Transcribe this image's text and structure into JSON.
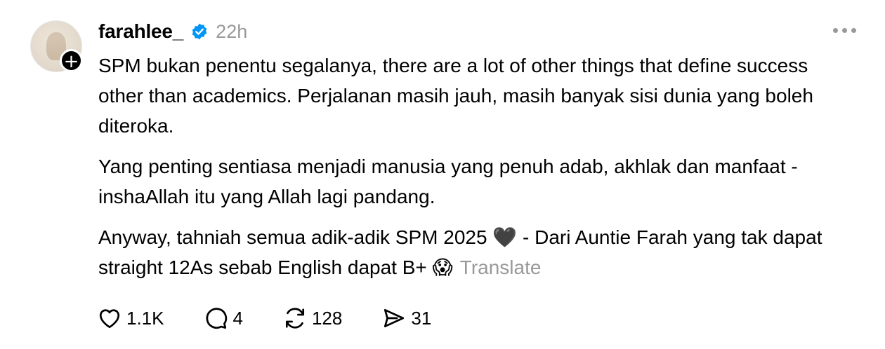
{
  "post": {
    "username": "farahlee_",
    "time": "22h",
    "paragraphs": [
      "SPM bukan penentu segalanya, there are a lot of other things that define success other than academics. Perjalanan masih jauh, masih banyak sisi dunia yang boleh diteroka.",
      "Yang penting sentiasa menjadi manusia yang penuh adab, akhlak dan manfaat - inshaAllah itu yang Allah lagi pandang."
    ],
    "last_paragraph": {
      "part1": "Anyway, tahniah semua adik-adik SPM 2025",
      "heart_emoji": "🖤",
      "part2": "- Dari Auntie Farah yang tak dapat straight 12As sebab English dapat B+",
      "face_emoji": "😱"
    },
    "translate_label": "Translate"
  },
  "actions": {
    "likes": "1.1K",
    "replies": "4",
    "reposts": "128",
    "shares": "31"
  },
  "icons": {
    "verified": "verified-badge-icon",
    "more": "more-options-icon",
    "like": "heart-icon",
    "reply": "comment-icon",
    "repost": "repost-icon",
    "share": "send-icon",
    "follow": "plus-icon"
  },
  "colors": {
    "verified_blue": "#0095f6",
    "muted_text": "#999999",
    "text": "#000000"
  }
}
